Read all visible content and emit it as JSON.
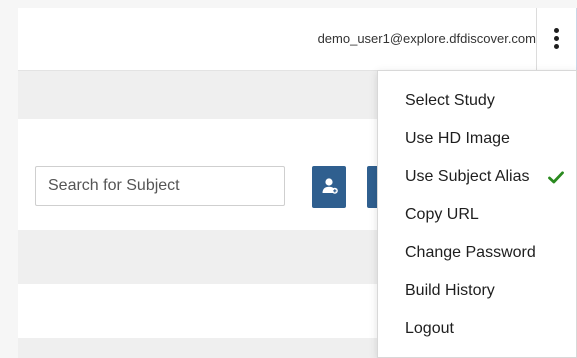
{
  "header": {
    "user_email": "demo_user1@explore.dfdiscover.com",
    "menu_icon": "kebab-vertical-icon"
  },
  "search": {
    "placeholder": "Search for Subject",
    "value": "",
    "add_subject_icon": "person-add-icon"
  },
  "menu": {
    "items": [
      {
        "label": "Select Study",
        "checked": false
      },
      {
        "label": "Use HD Image",
        "checked": false
      },
      {
        "label": "Use Subject Alias",
        "checked": true,
        "check_icon": "checkmark-icon"
      },
      {
        "label": "Copy URL",
        "checked": false
      },
      {
        "label": "Change Password",
        "checked": false
      },
      {
        "label": "Build History",
        "checked": false
      },
      {
        "label": "Logout",
        "checked": false
      }
    ]
  },
  "colors": {
    "primary_button": "#2f5f8f",
    "check": "#2a8a1f",
    "band": "#efefef"
  }
}
